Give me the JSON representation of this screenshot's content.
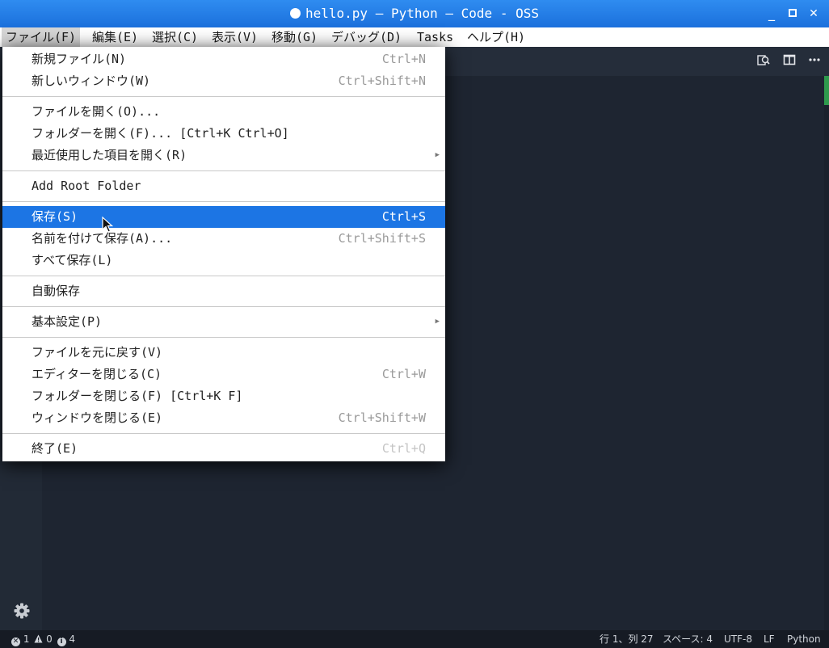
{
  "window": {
    "title": "hello.py — Python — Code - OSS",
    "controls": [
      "_",
      "▫",
      "✕"
    ]
  },
  "menubar": [
    "ファイル(F)",
    "編集(E)",
    "選択(C)",
    "表示(V)",
    "移動(G)",
    "デバッグ(D)",
    "Tasks",
    "ヘルプ(H)"
  ],
  "file_menu": {
    "new_file": {
      "label": "新規ファイル(N)",
      "shortcut": "Ctrl+N"
    },
    "new_window": {
      "label": "新しいウィンドウ(W)",
      "shortcut": "Ctrl+Shift+N"
    },
    "open_file": {
      "label": "ファイルを開く(O)..."
    },
    "open_folder": {
      "label": "フォルダーを開く(F)... [Ctrl+K Ctrl+O]"
    },
    "open_recent": {
      "label": "最近使用した項目を開く(R)"
    },
    "add_root": {
      "label": "Add Root Folder"
    },
    "save": {
      "label": "保存(S)",
      "shortcut": "Ctrl+S"
    },
    "save_as": {
      "label": "名前を付けて保存(A)...",
      "shortcut": "Ctrl+Shift+S"
    },
    "save_all": {
      "label": "すべて保存(L)"
    },
    "auto_save": {
      "label": "自動保存"
    },
    "preferences": {
      "label": "基本設定(P)"
    },
    "revert": {
      "label": "ファイルを元に戻す(V)"
    },
    "close_editor": {
      "label": "エディターを閉じる(C)",
      "shortcut": "Ctrl+W"
    },
    "close_folder": {
      "label": "フォルダーを閉じる(F) [Ctrl+K F]"
    },
    "close_window": {
      "label": "ウィンドウを閉じる(E)",
      "shortcut": "Ctrl+Shift+W"
    },
    "exit": {
      "label": "終了(E)",
      "shortcut": "Ctrl+Q"
    }
  },
  "statusbar": {
    "errors": "1",
    "warnings": "0",
    "infos": "4",
    "position": "行 1、列 27",
    "spaces": "スペース: 4",
    "encoding": "UTF-8",
    "eol": "LF",
    "language": "Python"
  },
  "colors": {
    "titlebar": "#1f78e0",
    "highlight": "#1c75e4",
    "editor_bg": "#1e2531",
    "statusbar_bg": "#161b24"
  }
}
